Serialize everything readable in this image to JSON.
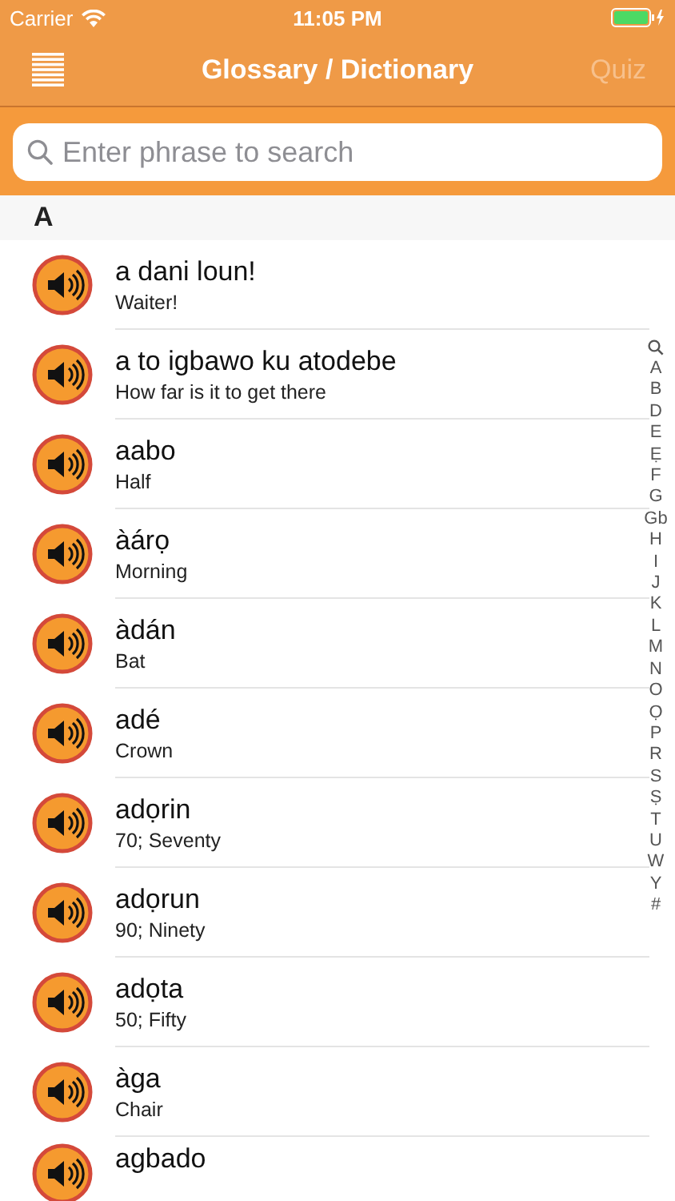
{
  "status_bar": {
    "carrier": "Carrier",
    "time": "11:05 PM"
  },
  "nav": {
    "title": "Glossary / Dictionary",
    "quiz": {
      "label": "Quiz",
      "disabled": true
    }
  },
  "search": {
    "placeholder": "Enter phrase to search"
  },
  "section": "A",
  "entries": [
    {
      "phrase": "a dani loun!",
      "meaning": "Waiter!"
    },
    {
      "phrase": "a to igbawo ku atodebe",
      "meaning": "How far is it to get there"
    },
    {
      "phrase": "aabo",
      "meaning": "Half"
    },
    {
      "phrase": "àárọ",
      "meaning": "Morning"
    },
    {
      "phrase": "àdán",
      "meaning": "Bat"
    },
    {
      "phrase": "adé",
      "meaning": "Crown"
    },
    {
      "phrase": "adọrin",
      "meaning": "70; Seventy"
    },
    {
      "phrase": "adọrun",
      "meaning": "90; Ninety"
    },
    {
      "phrase": "adọta",
      "meaning": "50; Fifty"
    },
    {
      "phrase": "àga",
      "meaning": "Chair"
    },
    {
      "phrase": "agbado"
    }
  ],
  "index": [
    "A",
    "B",
    "D",
    "E",
    "Ẹ",
    "F",
    "G",
    "Gb",
    "H",
    "I",
    "J",
    "K",
    "L",
    "M",
    "N",
    "O",
    "Ọ",
    "P",
    "R",
    "S",
    "Ṣ",
    "T",
    "U",
    "W",
    "Y",
    "#"
  ]
}
